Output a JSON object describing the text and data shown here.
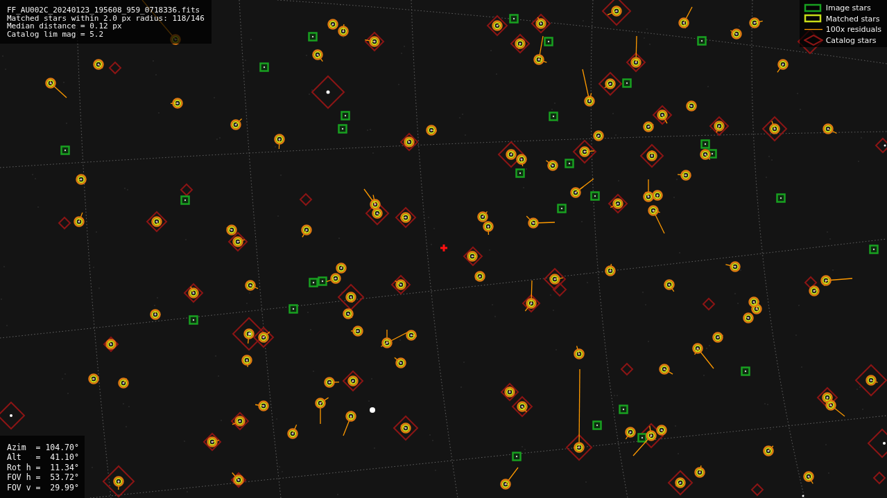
{
  "file_info": {
    "lines": [
      "FF_AU002C_20240123_195608_959_0718336.fits",
      "Matched stars within 2.0 px radius: 118/146",
      "Median distance = 0.12 px",
      "Catalog lim mag = 5.2"
    ]
  },
  "legend": [
    {
      "kind": "image",
      "label": "Image stars"
    },
    {
      "kind": "matched",
      "label": "Matched stars"
    },
    {
      "kind": "residual",
      "label": "100x residuals"
    },
    {
      "kind": "catalog",
      "label": "Catalog stars"
    }
  ],
  "pointing": {
    "lines": [
      "Azim  = 104.70°",
      "Alt   =  41.10°",
      "Rot h =  11.34°",
      "FOV h =  53.72°",
      "FOV v =  29.99°"
    ]
  }
}
